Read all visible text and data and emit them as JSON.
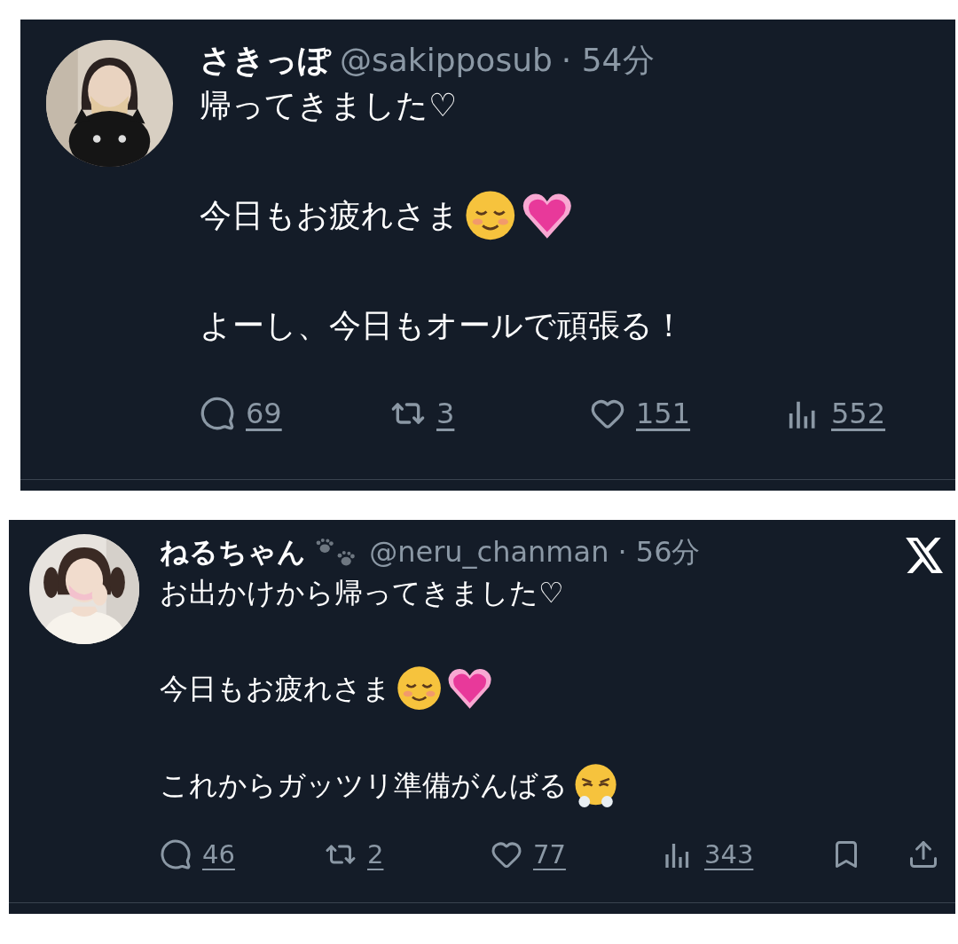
{
  "posts": [
    {
      "name": "さきっぽ",
      "handle": "@sakipposub",
      "time": "· 54分",
      "avatar": {
        "kind": "picture"
      },
      "brand_mark": false,
      "paragraphs": [
        {
          "text": "帰ってきました♡"
        },
        {
          "text": "今日もお疲れさま",
          "emojis": [
            {
              "kind": "smiling"
            },
            {
              "kind": "heart"
            }
          ]
        },
        {
          "text": "よーし、今日もオールで頑張る！"
        }
      ],
      "actions": [
        {
          "kind": "reply",
          "count": "69"
        },
        {
          "kind": "repost",
          "count": "3"
        },
        {
          "kind": "like",
          "count": "151"
        },
        {
          "kind": "views",
          "count": "552"
        }
      ]
    },
    {
      "name": "ねるちゃん",
      "name_badge": {
        "kind": "paw"
      },
      "handle": "@neru_chanman",
      "time": "· 56分",
      "avatar": {
        "kind": "picture"
      },
      "brand_mark": true,
      "paragraphs": [
        {
          "text": "お出かけから帰ってきました♡"
        },
        {
          "text": "今日もお疲れさま",
          "emojis": [
            {
              "kind": "smiling"
            },
            {
              "kind": "heart"
            }
          ]
        },
        {
          "text": "これからガッツリ準備がんばる",
          "emojis": [
            {
              "kind": "huffing"
            }
          ]
        }
      ],
      "actions": [
        {
          "kind": "reply",
          "count": "46"
        },
        {
          "kind": "repost",
          "count": "2"
        },
        {
          "kind": "like",
          "count": "77"
        },
        {
          "kind": "views",
          "count": "343"
        },
        {
          "kind": "bookmark"
        },
        {
          "kind": "share"
        }
      ]
    }
  ]
}
